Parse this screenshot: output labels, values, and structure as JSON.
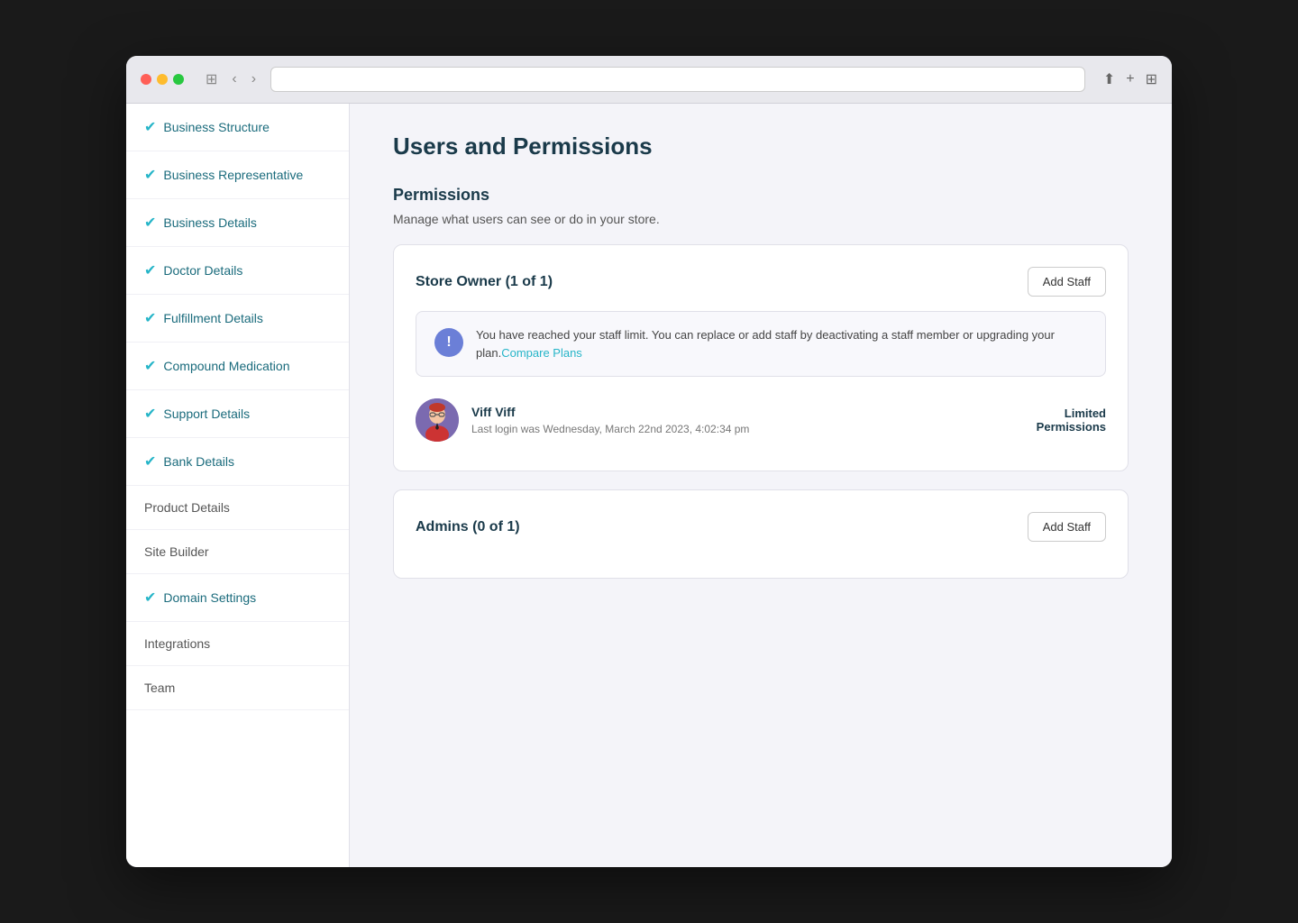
{
  "browser": {
    "traffic_lights": [
      "red",
      "yellow",
      "green"
    ],
    "back_icon": "‹",
    "forward_icon": "›"
  },
  "sidebar": {
    "items": [
      {
        "id": "business-structure",
        "label": "Business Structure",
        "checked": true,
        "visible": "partial"
      },
      {
        "id": "business-representative",
        "label": "Business Representative",
        "checked": true,
        "visible": true
      },
      {
        "id": "business-details",
        "label": "Business Details",
        "checked": true,
        "visible": true
      },
      {
        "id": "doctor-details",
        "label": "Doctor Details",
        "checked": true,
        "visible": true
      },
      {
        "id": "fulfillment-details",
        "label": "Fulfillment Details",
        "checked": true,
        "visible": true
      },
      {
        "id": "compound-medication",
        "label": "Compound Medication",
        "checked": true,
        "visible": true
      },
      {
        "id": "support-details",
        "label": "Support Details",
        "checked": true,
        "visible": true
      },
      {
        "id": "bank-details",
        "label": "Bank Details",
        "checked": true,
        "visible": true
      },
      {
        "id": "product-details",
        "label": "Product Details",
        "checked": false,
        "visible": true
      },
      {
        "id": "site-builder",
        "label": "Site Builder",
        "checked": false,
        "visible": true
      },
      {
        "id": "domain-settings",
        "label": "Domain Settings",
        "checked": true,
        "visible": true
      },
      {
        "id": "integrations",
        "label": "Integrations",
        "checked": false,
        "visible": true
      },
      {
        "id": "team",
        "label": "Team",
        "checked": false,
        "visible": true
      }
    ]
  },
  "main": {
    "page_title": "Users and Permissions",
    "permissions_section": {
      "title": "Permissions",
      "subtitle": "Manage what users can see or do in your store."
    },
    "store_owner_card": {
      "title": "Store Owner (1 of 1)",
      "add_staff_label": "Add Staff",
      "warning": {
        "icon": "!",
        "text": "You have reached your staff limit. You can replace or add staff by deactivating a staff member or upgrading your plan.",
        "link_text": "Compare Plans"
      },
      "staff_member": {
        "name": "Viff Viff",
        "last_login": "Last login was Wednesday, March 22nd 2023, 4:02:34 pm",
        "permissions": "Limited",
        "permissions_sub": "Permissions",
        "avatar_emoji": "🧑"
      }
    },
    "admins_card": {
      "title": "Admins (0 of 1)",
      "add_staff_label": "Add Staff"
    }
  }
}
